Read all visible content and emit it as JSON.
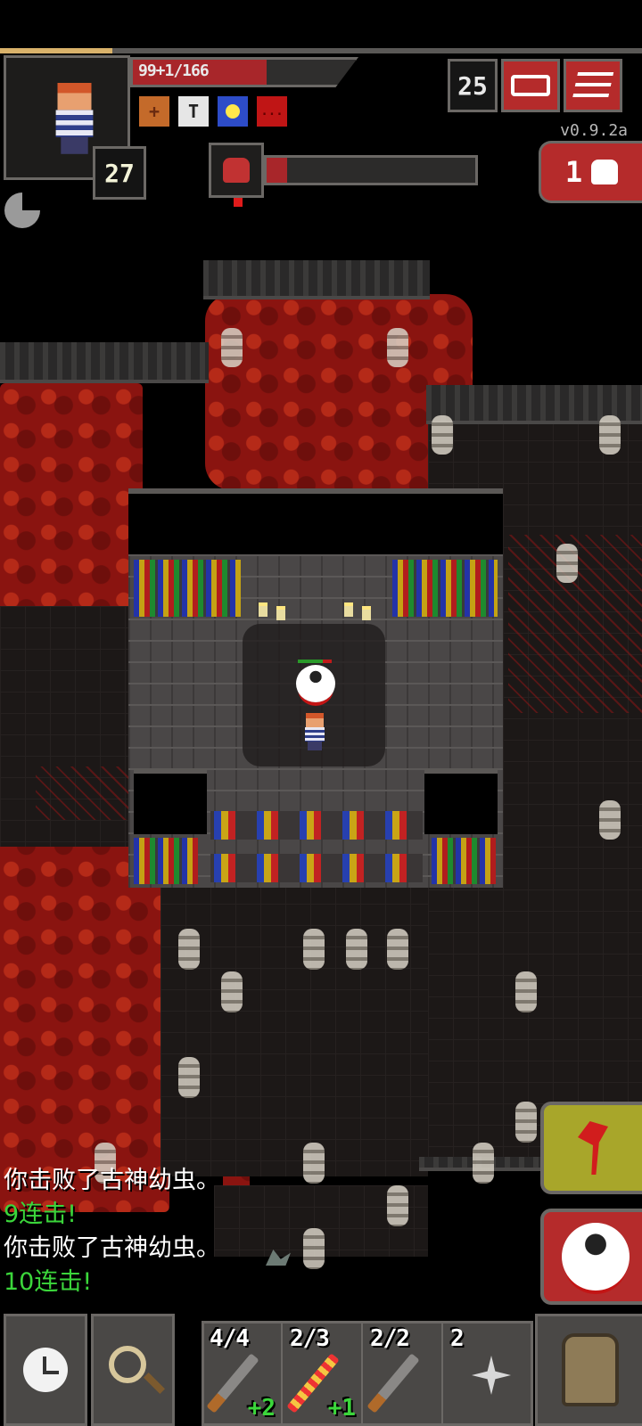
{
  "hero": {
    "level": "27",
    "hp_text": "99+1/166",
    "hp_fraction": 0.6,
    "xp_fraction": 0.175
  },
  "status": {
    "buffs": [
      "+",
      "T",
      "",
      "..."
    ]
  },
  "boss": {
    "hp_fraction": 0.1
  },
  "hud": {
    "depth": "25",
    "version": "v0.9.2a",
    "danger_count": "1"
  },
  "log": [
    {
      "text": "你击败了古神幼虫。",
      "color": "white"
    },
    {
      "text": "9连击!",
      "color": "green"
    },
    {
      "text": "你击败了古神幼虫。",
      "color": "white"
    },
    {
      "text": "10连击!",
      "color": "green"
    }
  ],
  "quickslots": [
    {
      "charges": "4/4",
      "upgrade": "+2",
      "item_icon": "wand-icon"
    },
    {
      "charges": "2/3",
      "upgrade": "+1",
      "item_icon": "firebolt-wand-icon"
    },
    {
      "charges": "2/2",
      "upgrade": "",
      "item_icon": "wand-icon"
    },
    {
      "charges": "2",
      "upgrade": "",
      "item_icon": "shuriken-icon"
    }
  ],
  "colors": {
    "hud_red": "#b52b2b",
    "attack_yellow": "#a8a62a",
    "log_green": "#3bd63b",
    "hp_red": "#a8262a"
  }
}
